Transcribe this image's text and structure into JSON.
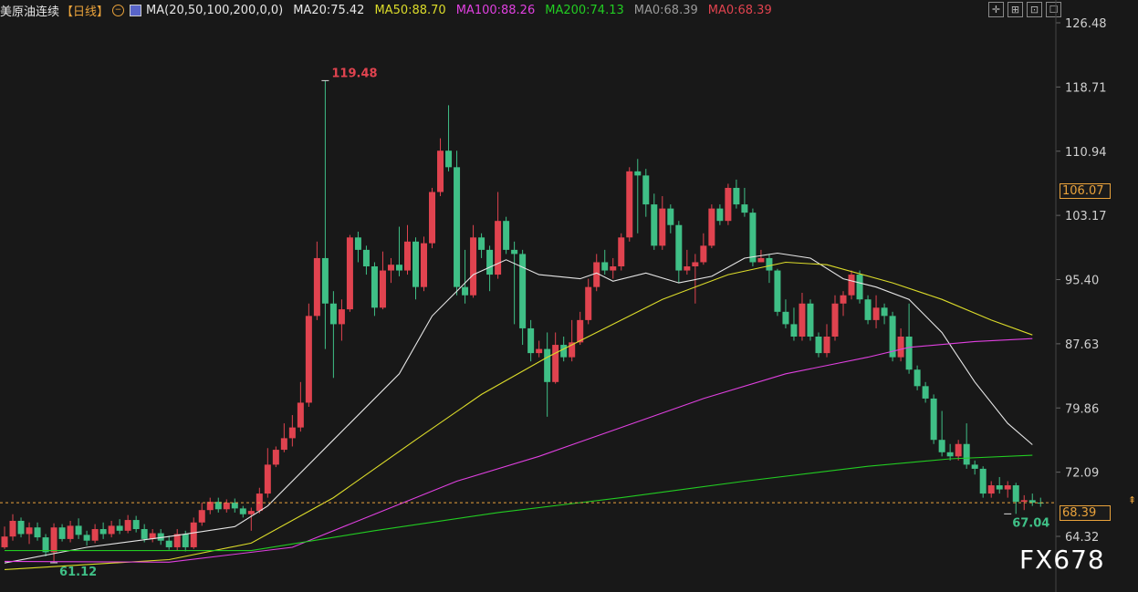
{
  "header": {
    "title": "美原油连续",
    "period": "【日线】",
    "ma_params": "MA(20,50,100,200,0,0)",
    "indicators": [
      {
        "text": "MA20:75.42",
        "color": "#e6e6e6"
      },
      {
        "text": "MA50:88.70",
        "color": "#dcdc2a"
      },
      {
        "text": "MA100:88.26",
        "color": "#e040e0"
      },
      {
        "text": "MA200:74.13",
        "color": "#22cc22"
      },
      {
        "text": "MA0:68.39",
        "color": "#9a9a9a"
      },
      {
        "text": "MA0:68.39",
        "color": "#e0434f"
      }
    ]
  },
  "toolbar": [
    "crosshair-icon",
    "grid-icon",
    "chart-icon",
    "window-icon"
  ],
  "price_tags": {
    "highlight": {
      "text": "106.07",
      "color": "#e9a23b"
    },
    "current": {
      "text": "68.39",
      "color": "#e9a23b"
    }
  },
  "annotations": {
    "high": "119.48",
    "low_left": "61.12",
    "low_right": "67.04"
  },
  "watermark": "FX678",
  "chart_data": {
    "type": "candlestick",
    "title": "美原油连续",
    "y_ticks": [
      "126.48",
      "118.71",
      "110.94",
      "103.17",
      "95.40",
      "87.63",
      "79.86",
      "72.09",
      "64.32"
    ],
    "ylim": [
      60.0,
      127.6
    ],
    "current_price": 68.39,
    "grid": false,
    "colors": {
      "up": "#e0434f",
      "down": "#3fbf86"
    },
    "candles": [
      [
        63.0,
        64.3,
        62.8,
        65.5
      ],
      [
        64.3,
        66.2,
        63.8,
        67.0
      ],
      [
        66.2,
        64.6,
        64.2,
        66.6
      ],
      [
        64.6,
        65.4,
        63.4,
        66.0
      ],
      [
        65.4,
        64.2,
        63.8,
        66.0
      ],
      [
        64.2,
        62.4,
        61.9,
        64.6
      ],
      [
        62.4,
        65.4,
        61.12,
        65.9
      ],
      [
        65.4,
        64.0,
        63.7,
        65.8
      ],
      [
        64.0,
        65.6,
        63.6,
        66.2
      ],
      [
        65.6,
        64.5,
        64.0,
        66.5
      ],
      [
        64.5,
        63.8,
        63.2,
        65.0
      ],
      [
        63.8,
        65.2,
        63.5,
        65.8
      ],
      [
        65.2,
        64.6,
        64.0,
        66.0
      ],
      [
        64.6,
        65.6,
        64.2,
        66.2
      ],
      [
        65.6,
        65.0,
        64.6,
        66.4
      ],
      [
        65.0,
        66.3,
        64.7,
        66.9
      ],
      [
        66.3,
        65.2,
        64.8,
        66.8
      ],
      [
        65.2,
        64.0,
        63.6,
        65.8
      ],
      [
        64.0,
        64.7,
        63.6,
        65.2
      ],
      [
        64.7,
        63.8,
        63.3,
        65.2
      ],
      [
        63.8,
        63.0,
        62.7,
        64.4
      ],
      [
        63.0,
        64.6,
        62.6,
        65.2
      ],
      [
        64.6,
        63.0,
        62.5,
        65.0
      ],
      [
        63.0,
        66.0,
        62.8,
        66.6
      ],
      [
        66.0,
        67.5,
        65.6,
        68.4
      ],
      [
        67.5,
        68.5,
        67.0,
        69.0
      ],
      [
        68.5,
        67.6,
        67.2,
        69.0
      ],
      [
        67.6,
        68.4,
        67.2,
        68.8
      ],
      [
        68.4,
        67.7,
        67.2,
        68.9
      ],
      [
        67.7,
        67.0,
        66.6,
        68.0
      ],
      [
        67.0,
        67.4,
        65.0,
        67.8
      ],
      [
        67.4,
        69.5,
        67.1,
        70.2
      ],
      [
        69.5,
        73.0,
        69.0,
        75.0
      ],
      [
        73.0,
        74.8,
        72.7,
        75.2
      ],
      [
        74.8,
        76.2,
        74.5,
        78.0
      ],
      [
        76.2,
        77.5,
        75.2,
        79.0
      ],
      [
        77.5,
        80.5,
        77.0,
        83.0
      ],
      [
        80.5,
        91.0,
        80.0,
        92.5
      ],
      [
        91.0,
        98.0,
        90.5,
        100.0
      ],
      [
        98.0,
        92.5,
        87.0,
        119.48
      ],
      [
        92.5,
        90.0,
        83.5,
        94.0
      ],
      [
        90.0,
        91.8,
        88.0,
        93.0
      ],
      [
        91.8,
        100.5,
        91.5,
        100.8
      ],
      [
        100.5,
        99.0,
        97.5,
        101.2
      ],
      [
        99.0,
        97.0,
        96.0,
        99.5
      ],
      [
        97.0,
        92.0,
        91.0,
        97.5
      ],
      [
        92.0,
        96.5,
        91.8,
        98.8
      ],
      [
        96.5,
        97.2,
        95.0,
        98.0
      ],
      [
        97.2,
        96.5,
        95.8,
        101.8
      ],
      [
        96.5,
        100.0,
        96.0,
        102.0
      ],
      [
        100.0,
        94.5,
        93.0,
        100.5
      ],
      [
        94.5,
        99.8,
        94.0,
        100.6
      ],
      [
        99.8,
        106.0,
        99.2,
        106.5
      ],
      [
        106.0,
        111.0,
        105.5,
        112.5
      ],
      [
        111.0,
        109.0,
        108.5,
        116.5
      ],
      [
        109.0,
        94.5,
        93.5,
        111.0
      ],
      [
        94.5,
        93.5,
        92.5,
        99.0
      ],
      [
        93.5,
        100.5,
        93.2,
        102.0
      ],
      [
        100.5,
        99.0,
        98.0,
        101.0
      ],
      [
        99.0,
        96.0,
        94.0,
        99.5
      ],
      [
        96.0,
        102.5,
        95.5,
        106.0
      ],
      [
        102.5,
        99.0,
        98.5,
        103.0
      ],
      [
        99.0,
        98.5,
        90.0,
        100.0
      ],
      [
        98.5,
        89.5,
        87.5,
        99.0
      ],
      [
        89.5,
        86.5,
        85.5,
        90.5
      ],
      [
        86.5,
        87.0,
        86.0,
        88.0
      ],
      [
        87.0,
        83.0,
        78.8,
        89.0
      ],
      [
        83.0,
        87.5,
        82.8,
        89.0
      ],
      [
        87.5,
        86.0,
        85.5,
        88.5
      ],
      [
        86.0,
        87.8,
        85.5,
        90.5
      ],
      [
        87.8,
        90.5,
        87.5,
        91.5
      ],
      [
        90.5,
        94.5,
        90.0,
        95.5
      ],
      [
        94.5,
        97.5,
        94.0,
        98.5
      ],
      [
        97.5,
        96.5,
        96.0,
        99.0
      ],
      [
        96.5,
        97.0,
        95.5,
        98.0
      ],
      [
        97.0,
        100.5,
        96.5,
        101.0
      ],
      [
        100.5,
        108.5,
        100.0,
        109.0
      ],
      [
        108.5,
        108.0,
        101.0,
        110.0
      ],
      [
        108.0,
        104.5,
        103.0,
        108.8
      ],
      [
        104.5,
        99.5,
        99.0,
        105.8
      ],
      [
        99.5,
        104.0,
        99.0,
        105.5
      ],
      [
        104.0,
        102.0,
        101.0,
        104.5
      ],
      [
        102.0,
        96.5,
        95.0,
        102.5
      ],
      [
        96.5,
        97.0,
        96.0,
        99.0
      ],
      [
        97.0,
        97.5,
        92.5,
        98.5
      ],
      [
        97.5,
        99.5,
        97.2,
        101.0
      ],
      [
        99.5,
        104.0,
        99.2,
        104.5
      ],
      [
        104.0,
        102.5,
        102.0,
        104.5
      ],
      [
        102.5,
        106.5,
        102.0,
        107.0
      ],
      [
        106.5,
        104.5,
        104.0,
        107.5
      ],
      [
        104.5,
        103.5,
        103.0,
        106.5
      ],
      [
        103.5,
        97.5,
        97.0,
        104.0
      ],
      [
        97.5,
        98.0,
        97.5,
        99.0
      ],
      [
        98.0,
        96.5,
        95.0,
        98.5
      ],
      [
        96.5,
        91.5,
        91.0,
        96.7
      ],
      [
        91.5,
        90.0,
        89.5,
        93.0
      ],
      [
        90.0,
        88.5,
        88.0,
        92.0
      ],
      [
        88.5,
        92.5,
        88.0,
        93.8
      ],
      [
        92.5,
        88.5,
        88.0,
        93.0
      ],
      [
        88.5,
        86.5,
        86.0,
        89.0
      ],
      [
        86.5,
        88.5,
        86.0,
        90.0
      ],
      [
        88.5,
        92.5,
        88.0,
        93.5
      ],
      [
        92.5,
        93.5,
        91.0,
        94.0
      ],
      [
        93.5,
        96.0,
        93.0,
        96.5
      ],
      [
        96.0,
        93.0,
        92.5,
        96.5
      ],
      [
        93.0,
        90.5,
        90.0,
        93.5
      ],
      [
        90.5,
        92.0,
        89.5,
        93.5
      ],
      [
        92.0,
        91.0,
        90.0,
        92.5
      ],
      [
        91.0,
        86.0,
        85.5,
        91.5
      ],
      [
        86.0,
        88.5,
        85.5,
        89.5
      ],
      [
        88.5,
        84.5,
        84.0,
        92.5
      ],
      [
        84.5,
        82.5,
        82.0,
        85.0
      ],
      [
        82.5,
        81.0,
        80.5,
        83.0
      ],
      [
        81.0,
        76.0,
        75.5,
        81.5
      ],
      [
        76.0,
        74.5,
        74.0,
        79.5
      ],
      [
        74.5,
        74.0,
        73.5,
        75.5
      ],
      [
        74.0,
        75.5,
        73.5,
        76.0
      ],
      [
        75.5,
        73.0,
        72.5,
        78.0
      ],
      [
        73.0,
        72.5,
        71.8,
        73.5
      ],
      [
        72.5,
        69.5,
        69.0,
        72.8
      ],
      [
        69.5,
        70.5,
        69.0,
        71.0
      ],
      [
        70.5,
        70.0,
        69.5,
        71.5
      ],
      [
        70.0,
        70.5,
        69.0,
        71.0
      ],
      [
        70.5,
        68.5,
        67.04,
        70.8
      ],
      [
        68.5,
        68.7,
        67.5,
        69.3
      ],
      [
        68.7,
        68.4,
        68.0,
        69.5
      ],
      [
        68.4,
        68.39,
        67.9,
        69.0
      ]
    ],
    "moving_averages": [
      {
        "label": "MA20",
        "color": "#e6e6e6",
        "points": [
          [
            0,
            61.1
          ],
          [
            10,
            63.0
          ],
          [
            20,
            64.3
          ],
          [
            28,
            65.5
          ],
          [
            32,
            68.0
          ],
          [
            40,
            76.0
          ],
          [
            48,
            84.0
          ],
          [
            52,
            91.0
          ],
          [
            57,
            96.0
          ],
          [
            61,
            97.8
          ],
          [
            65,
            96.0
          ],
          [
            70,
            95.5
          ],
          [
            72,
            96.2
          ],
          [
            74,
            95.2
          ],
          [
            78,
            96.2
          ],
          [
            82,
            95.0
          ],
          [
            86,
            95.8
          ],
          [
            90,
            98.0
          ],
          [
            94,
            98.6
          ],
          [
            98,
            98.0
          ],
          [
            102,
            95.5
          ],
          [
            106,
            94.5
          ],
          [
            110,
            93.0
          ],
          [
            114,
            89.0
          ],
          [
            118,
            83.0
          ],
          [
            122,
            78.0
          ],
          [
            125,
            75.42
          ]
        ]
      },
      {
        "label": "MA50",
        "color": "#dcdc2a",
        "points": [
          [
            0,
            60.3
          ],
          [
            20,
            61.5
          ],
          [
            30,
            63.5
          ],
          [
            40,
            69.0
          ],
          [
            50,
            76.0
          ],
          [
            58,
            81.5
          ],
          [
            66,
            86.0
          ],
          [
            72,
            89.0
          ],
          [
            80,
            93.0
          ],
          [
            88,
            96.0
          ],
          [
            95,
            97.5
          ],
          [
            100,
            97.2
          ],
          [
            108,
            95.0
          ],
          [
            114,
            93.0
          ],
          [
            120,
            90.5
          ],
          [
            125,
            88.7
          ]
        ]
      },
      {
        "label": "MA100",
        "color": "#e040e0",
        "points": [
          [
            0,
            61.3
          ],
          [
            20,
            61.2
          ],
          [
            35,
            63.0
          ],
          [
            45,
            67.0
          ],
          [
            55,
            71.0
          ],
          [
            65,
            74.0
          ],
          [
            75,
            77.5
          ],
          [
            85,
            81.0
          ],
          [
            95,
            84.0
          ],
          [
            105,
            86.0
          ],
          [
            110,
            87.2
          ],
          [
            118,
            87.9
          ],
          [
            125,
            88.26
          ]
        ]
      },
      {
        "label": "MA200",
        "color": "#22cc22",
        "points": [
          [
            0,
            62.6
          ],
          [
            30,
            62.6
          ],
          [
            45,
            65.0
          ],
          [
            60,
            67.2
          ],
          [
            75,
            69.0
          ],
          [
            90,
            71.0
          ],
          [
            105,
            72.8
          ],
          [
            115,
            73.7
          ],
          [
            125,
            74.13
          ]
        ]
      }
    ]
  }
}
